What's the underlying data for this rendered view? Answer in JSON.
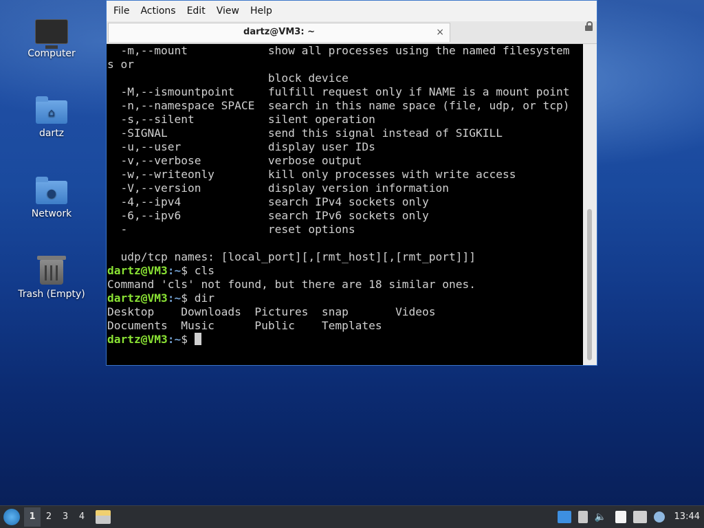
{
  "desktop": {
    "icons": [
      {
        "label": "Computer",
        "icon": "computer-icon"
      },
      {
        "label": "dartz",
        "icon": "home-folder-icon"
      },
      {
        "label": "Network",
        "icon": "network-folder-icon"
      },
      {
        "label": "Trash (Empty)",
        "icon": "trash-icon"
      }
    ]
  },
  "window": {
    "menu": [
      "File",
      "Actions",
      "Edit",
      "View",
      "Help"
    ],
    "tab_title": "dartz@VM3: ~",
    "tab_close": "×",
    "prompt_user": "dartz@VM3",
    "prompt_path": ":~",
    "prompt_symbol": "$ ",
    "terminal": {
      "help_lines": [
        "  -m,--mount            show all processes using the named filesystem",
        "s or",
        "                        block device",
        "  -M,--ismountpoint     fulfill request only if NAME is a mount point",
        "  -n,--namespace SPACE  search in this name space (file, udp, or tcp)",
        "  -s,--silent           silent operation",
        "  -SIGNAL               send this signal instead of SIGKILL",
        "  -u,--user             display user IDs",
        "  -v,--verbose          verbose output",
        "  -w,--writeonly        kill only processes with write access",
        "  -V,--version          display version information",
        "  -4,--ipv4             search IPv4 sockets only",
        "  -6,--ipv6             search IPv6 sockets only",
        "  -                     reset options",
        "",
        "  udp/tcp names: [local_port][,[rmt_host][,[rmt_port]]]",
        ""
      ],
      "cmd1": "cls",
      "out1": "Command 'cls' not found, but there are 18 similar ones.",
      "cmd2": "dir",
      "dir_line1": "Desktop    Downloads  Pictures  snap       Videos",
      "dir_line2": "Documents  Music      Public    Templates"
    }
  },
  "taskbar": {
    "workspaces": [
      "1",
      "2",
      "3",
      "4"
    ],
    "active_workspace": "1",
    "clock": "13:44",
    "tray_icons": [
      "display-icon",
      "clipboard-icon",
      "volume-icon",
      "notes-icon",
      "network-icon",
      "notification-icon"
    ]
  }
}
